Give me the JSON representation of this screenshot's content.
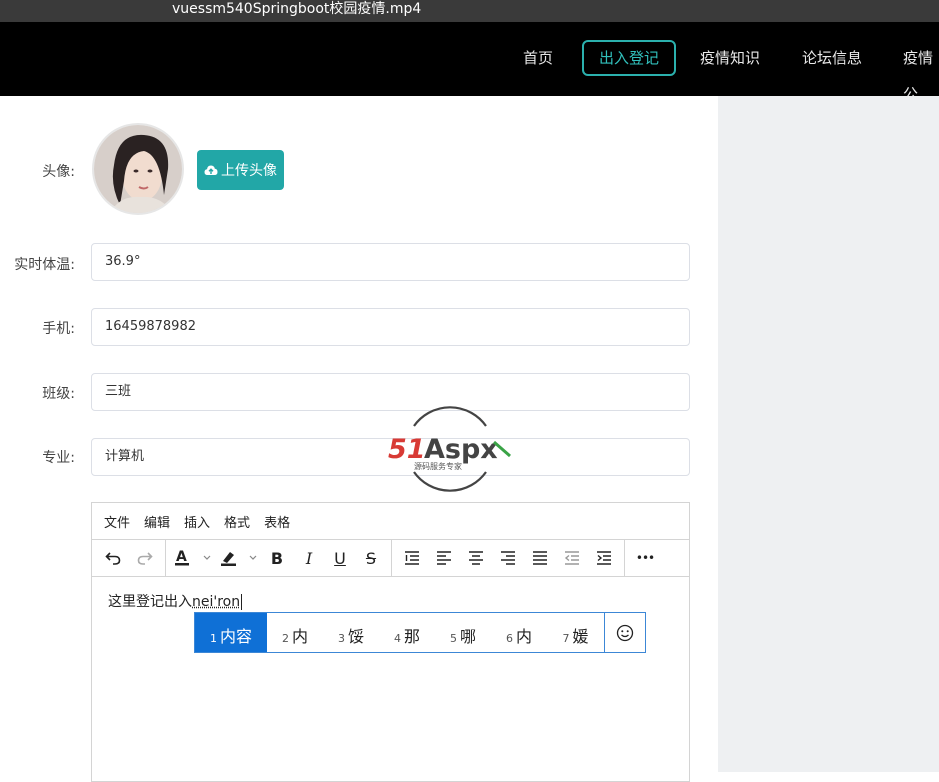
{
  "window": {
    "title": "vuessm540Springboot校园疫情.mp4"
  },
  "nav": {
    "items": [
      {
        "label": "首页",
        "active": false
      },
      {
        "label": "出入登记",
        "active": true
      },
      {
        "label": "疫情知识",
        "active": false
      },
      {
        "label": "论坛信息",
        "active": false
      },
      {
        "label": "疫情公",
        "active": false
      }
    ],
    "accent": "#2bb0ad"
  },
  "form": {
    "avatar_label": "头像:",
    "upload_label": "上传头像",
    "temperature": {
      "label": "实时体温:",
      "value": "36.9°"
    },
    "phone": {
      "label": "手机:",
      "value": "16459878982"
    },
    "class": {
      "label": "班级:",
      "value": "三班"
    },
    "major": {
      "label": "专业:",
      "value": "计算机"
    }
  },
  "editor": {
    "menu": [
      "文件",
      "编辑",
      "插入",
      "格式",
      "表格"
    ],
    "toolbar_icons": [
      "undo-icon",
      "redo-icon",
      "text-color-icon",
      "highlight-icon",
      "bold-icon",
      "italic-icon",
      "underline-icon",
      "strikethrough-icon",
      "line-height-icon",
      "align-left-icon",
      "align-center-icon",
      "align-right-icon",
      "align-justify-icon",
      "outdent-icon",
      "indent-icon",
      "more-icon"
    ],
    "bold_glyph": "B",
    "italic_glyph": "I",
    "underline_glyph": "U",
    "strike_glyph": "S",
    "more_glyph": "•••",
    "content_text": "这里登记出入",
    "composition": "nei'ron"
  },
  "ime": {
    "candidates": [
      {
        "num": "1",
        "text": "内容"
      },
      {
        "num": "2",
        "text": "内"
      },
      {
        "num": "3",
        "text": "馁"
      },
      {
        "num": "4",
        "text": "那"
      },
      {
        "num": "5",
        "text": "哪"
      },
      {
        "num": "6",
        "text": "内"
      },
      {
        "num": "7",
        "text": "媛"
      }
    ],
    "selected_index": 0
  },
  "watermark": {
    "brand": "51Aspx",
    "tagline": "源码服务专家"
  }
}
